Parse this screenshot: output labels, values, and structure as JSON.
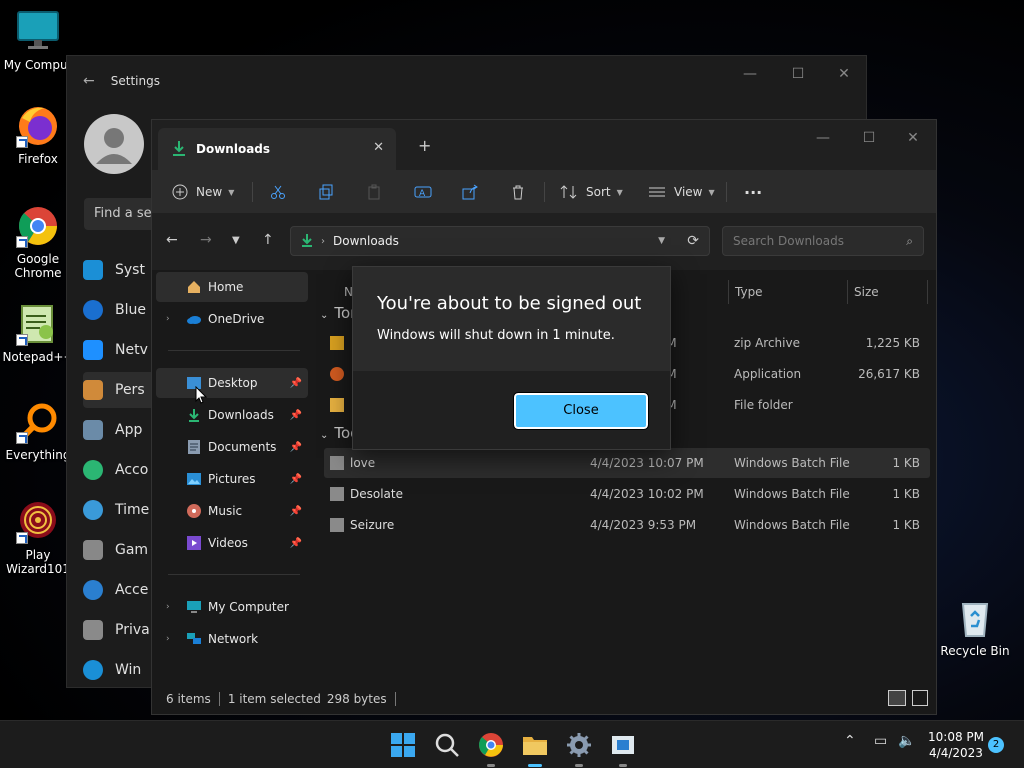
{
  "desktop": {
    "icons": [
      {
        "label": "My Comput",
        "icon": "monitor-icon"
      },
      {
        "label": "Firefox",
        "icon": "firefox-icon"
      },
      {
        "label": "Google Chrome",
        "icon": "chrome-icon"
      },
      {
        "label": "Notepad++",
        "icon": "notepad-icon"
      },
      {
        "label": "Everything",
        "icon": "everything-icon"
      },
      {
        "label": "Play Wizard101",
        "icon": "wizard101-icon"
      },
      {
        "label": "Recycle Bin",
        "icon": "recycle-bin-icon"
      }
    ]
  },
  "settings": {
    "title": "Settings",
    "search_placeholder": "Find a set",
    "nav": [
      {
        "label": "Syst",
        "icon": "system-icon"
      },
      {
        "label": "Blue",
        "icon": "bluetooth-icon"
      },
      {
        "label": "Netv",
        "icon": "network-icon"
      },
      {
        "label": "Pers",
        "icon": "personalization-icon"
      },
      {
        "label": "App",
        "icon": "apps-icon"
      },
      {
        "label": "Acco",
        "icon": "accounts-icon"
      },
      {
        "label": "Time",
        "icon": "time-icon"
      },
      {
        "label": "Gam",
        "icon": "gaming-icon"
      },
      {
        "label": "Acce",
        "icon": "accessibility-icon"
      },
      {
        "label": "Priva",
        "icon": "privacy-icon"
      },
      {
        "label": "Win",
        "icon": "update-icon"
      }
    ]
  },
  "explorer": {
    "tab_title": "Downloads",
    "toolbar": {
      "new_label": "New",
      "sort_label": "Sort",
      "view_label": "View",
      "more_label": "···"
    },
    "address": {
      "path": "Downloads",
      "search_placeholder": "Search Downloads"
    },
    "sidebar": [
      {
        "label": "Home",
        "icon": "home-icon"
      },
      {
        "label": "OneDrive",
        "icon": "onedrive-icon"
      },
      {
        "label": "Desktop",
        "icon": "desktop-folder-icon"
      },
      {
        "label": "Downloads",
        "icon": "downloads-icon"
      },
      {
        "label": "Documents",
        "icon": "documents-icon"
      },
      {
        "label": "Pictures",
        "icon": "pictures-icon"
      },
      {
        "label": "Music",
        "icon": "music-icon"
      },
      {
        "label": "Videos",
        "icon": "videos-icon"
      },
      {
        "label": "My Computer",
        "icon": "computer-icon"
      },
      {
        "label": "Network",
        "icon": "network-icon"
      }
    ],
    "columns": {
      "name": "N",
      "type": "Type",
      "size": "Size"
    },
    "groups": [
      "Tor",
      "Tod"
    ],
    "rows_top": [
      {
        "name": "",
        "date": "AM",
        "type": "zip Archive",
        "size": "1,225 KB"
      },
      {
        "name": "",
        "date": "AM",
        "type": "Application",
        "size": "26,617 KB"
      },
      {
        "name": "",
        "date": "AM",
        "type": "File folder",
        "size": ""
      }
    ],
    "rows_today": [
      {
        "name": "love",
        "date": "4/4/2023 10:07 PM",
        "type": "Windows Batch File",
        "size": "1 KB"
      },
      {
        "name": "Desolate",
        "date": "4/4/2023 10:02 PM",
        "type": "Windows Batch File",
        "size": "1 KB"
      },
      {
        "name": "Seizure",
        "date": "4/4/2023 9:53 PM",
        "type": "Windows Batch File",
        "size": "1 KB"
      }
    ],
    "status": {
      "items": "6 items",
      "selected": "1 item selected",
      "bytes": "298 bytes"
    }
  },
  "dialog": {
    "title": "You're about to be signed out",
    "message": "Windows will shut down in 1 minute.",
    "close_label": "Close"
  },
  "taskbar": {
    "time": "10:08 PM",
    "date": "4/4/2023",
    "notifications": "2"
  },
  "colors": {
    "accent": "#4cc2ff",
    "window_bg": "#191919",
    "toolbar_bg": "#2b2b2b"
  }
}
